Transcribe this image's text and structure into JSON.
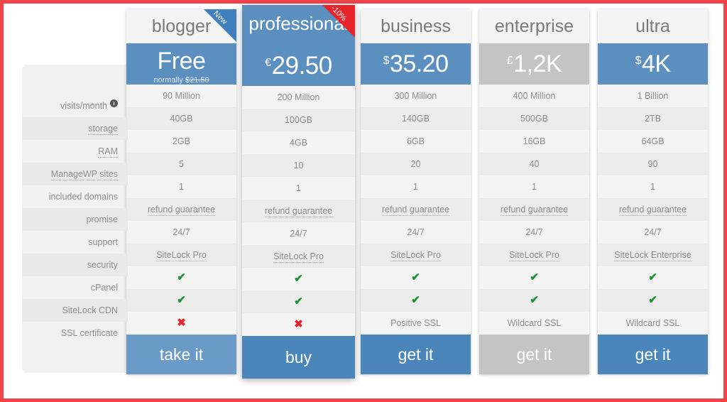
{
  "theme": {
    "frame_border_color": "#f0444a",
    "accent_blue": "#5b8fc0",
    "cta_blue": "#4a86ba",
    "muted_gray": "#c4c4c4",
    "yes_green": "#1b9033",
    "no_red": "#e8242a"
  },
  "features": [
    {
      "label": "visits/month",
      "style": "plain",
      "has_info_icon": true
    },
    {
      "label": "storage",
      "style": "dotted",
      "has_info_icon": false
    },
    {
      "label": "RAM",
      "style": "dotted",
      "has_info_icon": false
    },
    {
      "label": "ManageWP sites",
      "style": "dotted",
      "has_info_icon": false
    },
    {
      "label": "included domains",
      "style": "plain",
      "has_info_icon": false
    },
    {
      "label": "promise",
      "style": "plain",
      "has_info_icon": false
    },
    {
      "label": "support",
      "style": "plain",
      "has_info_icon": false
    },
    {
      "label": "security",
      "style": "plain",
      "has_info_icon": false
    },
    {
      "label": "cPanel",
      "style": "plain",
      "has_info_icon": false
    },
    {
      "label": "SiteLock CDN",
      "style": "plain",
      "has_info_icon": false
    },
    {
      "label": "SSL certificate",
      "style": "plain",
      "has_info_icon": false
    }
  ],
  "plans": [
    {
      "name": "blogger",
      "ribbon": {
        "text": "New",
        "color": "blue"
      },
      "price": {
        "currency": "",
        "amount": "Free",
        "note_prefix": "normally ",
        "note_struck": "$21.50"
      },
      "price_style": "blue",
      "featured": false,
      "cta": {
        "label": "take it",
        "style": "light"
      },
      "cells": [
        {
          "text": "90 Million",
          "type": "text"
        },
        {
          "text": "40GB",
          "type": "text"
        },
        {
          "text": "2GB",
          "type": "text"
        },
        {
          "text": "5",
          "type": "text"
        },
        {
          "text": "1",
          "type": "text"
        },
        {
          "text": "refund guarantee",
          "type": "link"
        },
        {
          "text": "24/7",
          "type": "text"
        },
        {
          "text": "SiteLock Pro",
          "type": "link"
        },
        {
          "text": "✔",
          "type": "yes"
        },
        {
          "text": "✔",
          "type": "yes"
        },
        {
          "text": "✖",
          "type": "no"
        }
      ]
    },
    {
      "name": "professional",
      "ribbon": {
        "text": "-10%",
        "color": "red"
      },
      "price": {
        "currency": "€",
        "amount": "29.50",
        "note_prefix": "",
        "note_struck": ""
      },
      "price_style": "blue",
      "featured": true,
      "cta": {
        "label": "buy",
        "style": "blue"
      },
      "cells": [
        {
          "text": "200 Million",
          "type": "text"
        },
        {
          "text": "100GB",
          "type": "text"
        },
        {
          "text": "4GB",
          "type": "text"
        },
        {
          "text": "10",
          "type": "text"
        },
        {
          "text": "1",
          "type": "text"
        },
        {
          "text": "refund guarantee",
          "type": "link"
        },
        {
          "text": "24/7",
          "type": "text"
        },
        {
          "text": "SiteLock Pro",
          "type": "link"
        },
        {
          "text": "✔",
          "type": "yes"
        },
        {
          "text": "✔",
          "type": "yes"
        },
        {
          "text": "✖",
          "type": "no"
        }
      ]
    },
    {
      "name": "business",
      "ribbon": null,
      "price": {
        "currency": "$",
        "amount": "35.20",
        "note_prefix": "",
        "note_struck": ""
      },
      "price_style": "blue",
      "featured": false,
      "cta": {
        "label": "get it",
        "style": "blue"
      },
      "cells": [
        {
          "text": "300 Million",
          "type": "text"
        },
        {
          "text": "140GB",
          "type": "text"
        },
        {
          "text": "6GB",
          "type": "text"
        },
        {
          "text": "20",
          "type": "text"
        },
        {
          "text": "1",
          "type": "text"
        },
        {
          "text": "refund guarantee",
          "type": "link"
        },
        {
          "text": "24/7",
          "type": "text"
        },
        {
          "text": "SiteLock Pro",
          "type": "link"
        },
        {
          "text": "✔",
          "type": "yes"
        },
        {
          "text": "✔",
          "type": "yes"
        },
        {
          "text": "Positive SSL",
          "type": "text"
        }
      ]
    },
    {
      "name": "enterprise",
      "ribbon": null,
      "price": {
        "currency": "£",
        "amount": "1,2K",
        "note_prefix": "",
        "note_struck": ""
      },
      "price_style": "muted",
      "featured": false,
      "cta": {
        "label": "get it",
        "style": "muted"
      },
      "cells": [
        {
          "text": "400 Million",
          "type": "text"
        },
        {
          "text": "500GB",
          "type": "text"
        },
        {
          "text": "16GB",
          "type": "text"
        },
        {
          "text": "40",
          "type": "text"
        },
        {
          "text": "1",
          "type": "text"
        },
        {
          "text": "refund guarantee",
          "type": "link"
        },
        {
          "text": "24/7",
          "type": "text"
        },
        {
          "text": "SiteLock Pro",
          "type": "link"
        },
        {
          "text": "✔",
          "type": "yes"
        },
        {
          "text": "✔",
          "type": "yes"
        },
        {
          "text": "Wildcard SSL",
          "type": "text"
        }
      ]
    },
    {
      "name": "ultra",
      "ribbon": null,
      "price": {
        "currency": "$",
        "amount": "4K",
        "note_prefix": "",
        "note_struck": ""
      },
      "price_style": "blue",
      "featured": false,
      "cta": {
        "label": "get it",
        "style": "blue"
      },
      "cells": [
        {
          "text": "1 Billion",
          "type": "text"
        },
        {
          "text": "2TB",
          "type": "text"
        },
        {
          "text": "64GB",
          "type": "text"
        },
        {
          "text": "90",
          "type": "text"
        },
        {
          "text": "1",
          "type": "text"
        },
        {
          "text": "refund guarantee",
          "type": "link"
        },
        {
          "text": "24/7",
          "type": "text"
        },
        {
          "text": "SiteLock Enterprise",
          "type": "link"
        },
        {
          "text": "✔",
          "type": "yes"
        },
        {
          "text": "✔",
          "type": "yes"
        },
        {
          "text": "Wildcard SSL",
          "type": "text"
        }
      ]
    }
  ]
}
